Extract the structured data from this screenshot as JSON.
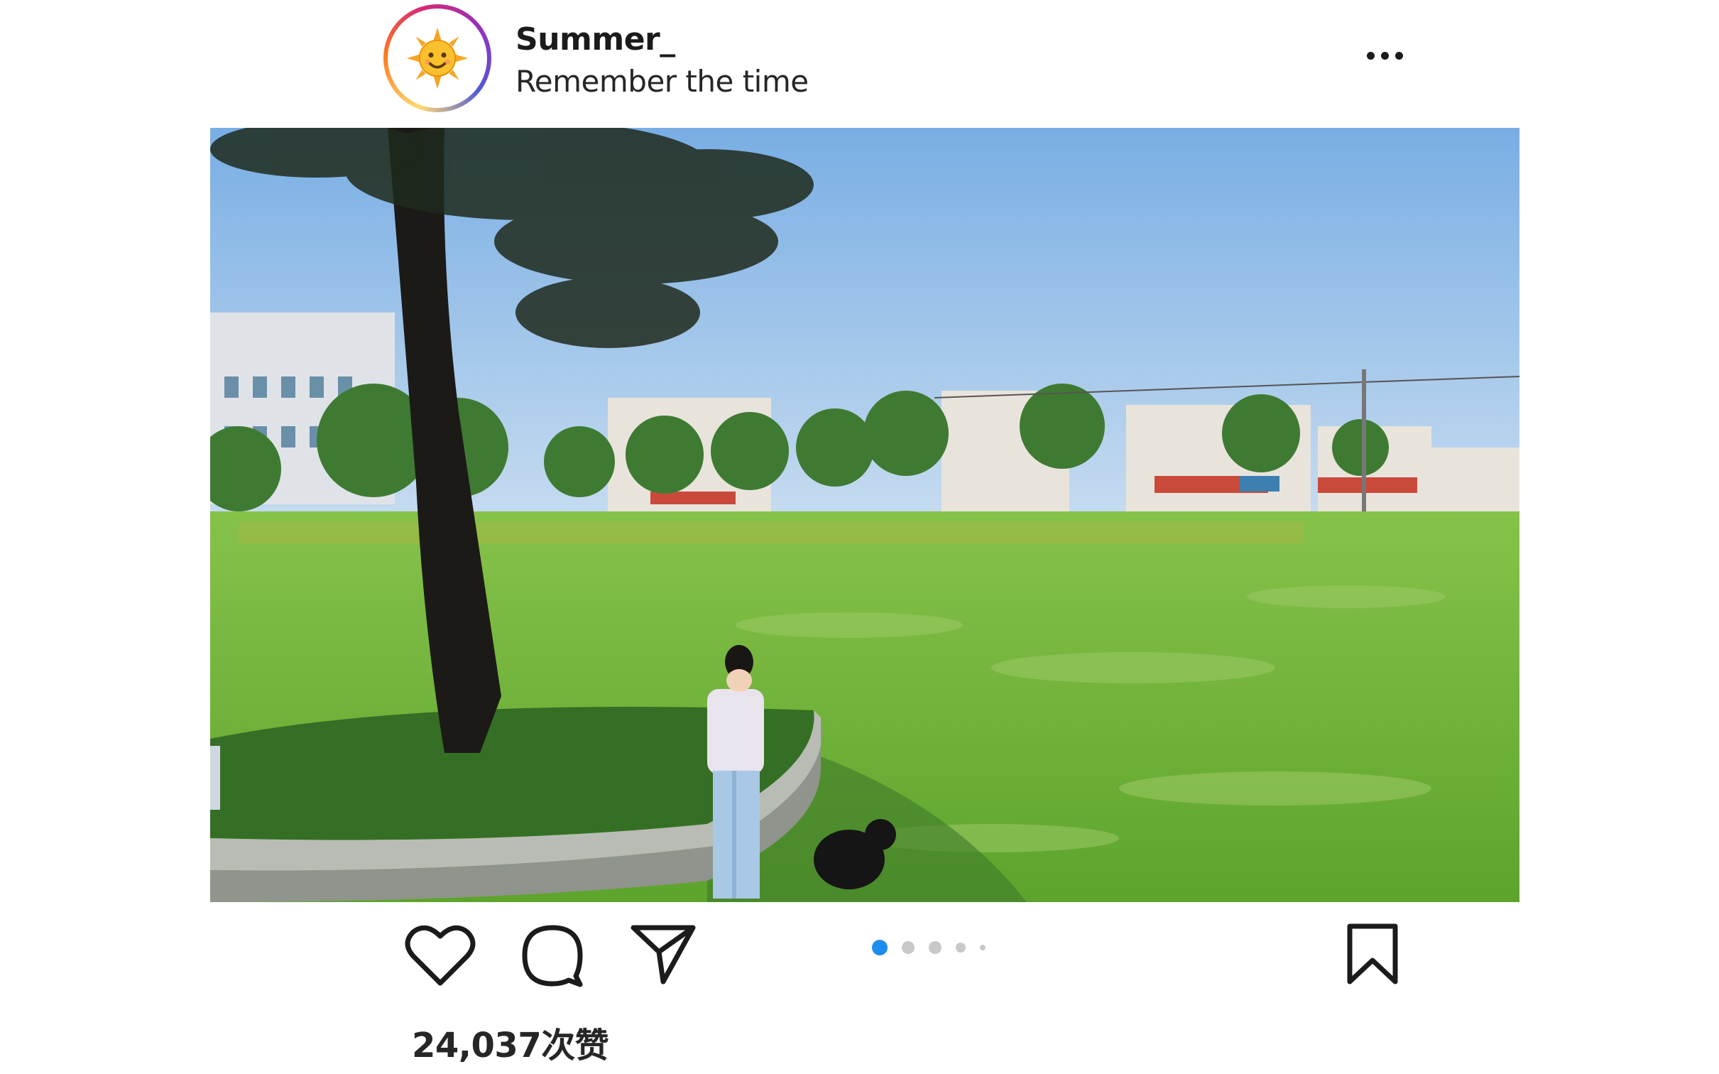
{
  "post": {
    "username": "Summer_",
    "subtitle": "Remember the time",
    "avatar_icon": "sun-emoji-icon",
    "menu_icon": "more-horizontal-icon",
    "likes_text": "24,037次赞"
  },
  "carousel": {
    "total_dots": 5,
    "active_index": 0,
    "active_color": "#1d8cf0"
  },
  "actions": [
    "heart-icon",
    "comment-icon",
    "share-icon",
    "bookmark-icon"
  ],
  "colors": {
    "text": "#262626",
    "sky": "#86b7e8",
    "grass": "#6cb43a"
  }
}
